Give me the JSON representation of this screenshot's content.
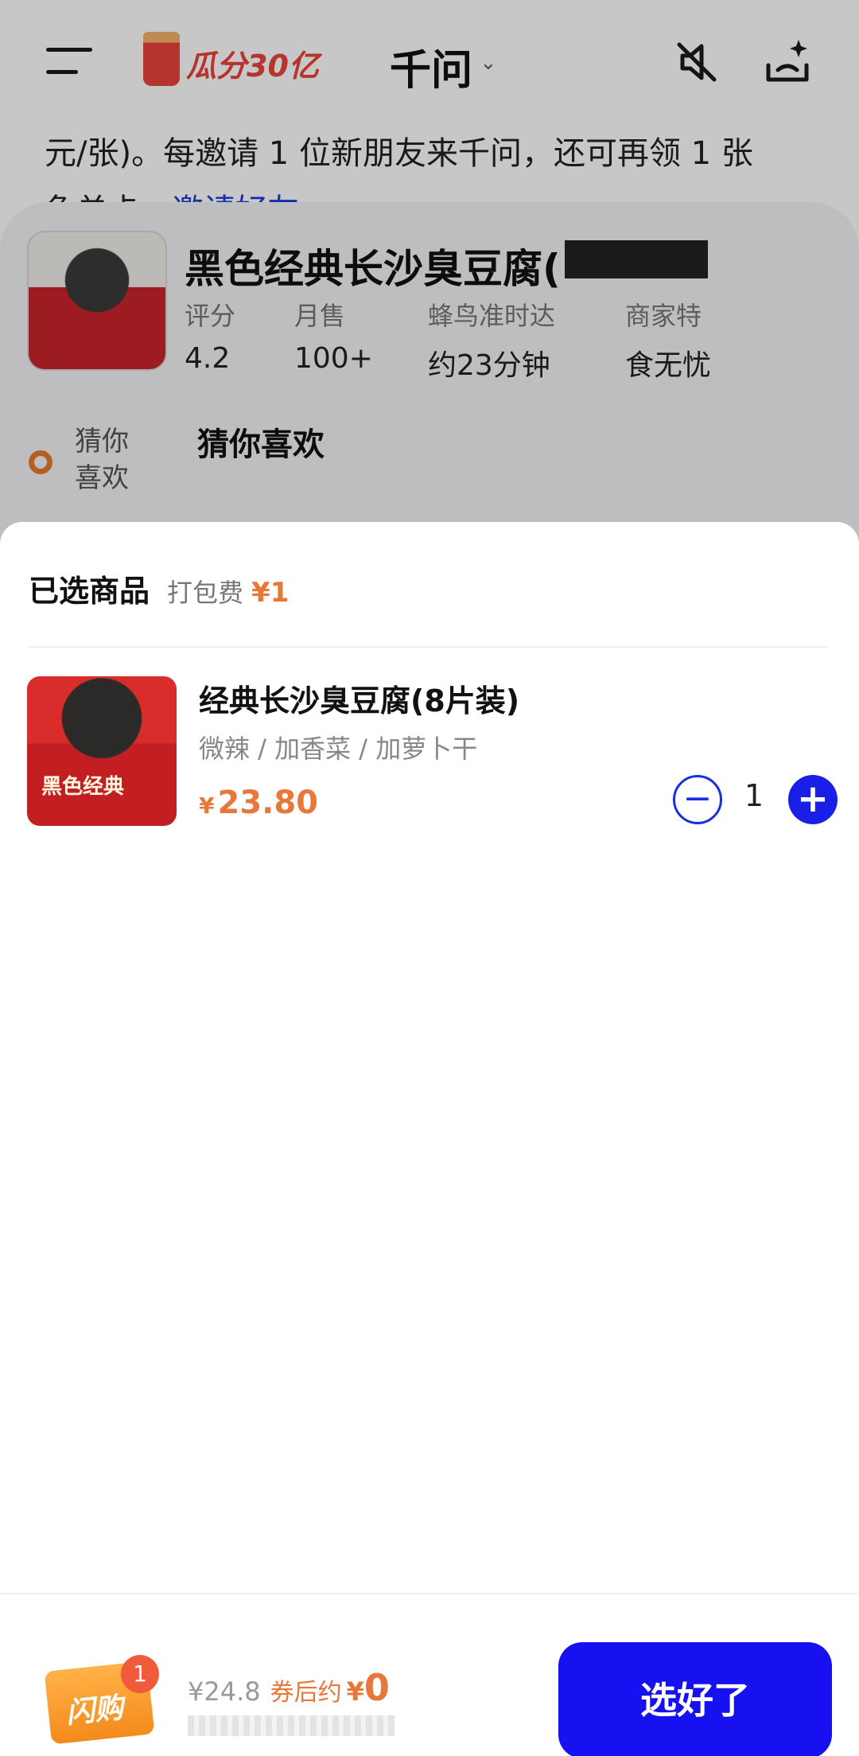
{
  "header": {
    "promo_text": "瓜分30亿",
    "app_title": "千问"
  },
  "chat": {
    "line1": "元/张)。每邀请 1 位新朋友来千问，还可再领 1 张",
    "line2_prefix": "免单卡，",
    "invite_link": "邀请好友"
  },
  "store": {
    "name": "黑色经典长沙臭豆腐(",
    "stats": [
      {
        "label": "评分",
        "value": "4.2"
      },
      {
        "label": "月售",
        "value": "100+"
      },
      {
        "label": "蜂鸟准时达",
        "value": "约23分钟"
      },
      {
        "label": "商家特",
        "value": "食无忧"
      }
    ],
    "guess_side": [
      "猜你",
      "喜欢"
    ],
    "guess_title": "猜你喜欢"
  },
  "cart": {
    "title": "已选商品",
    "pack_label": "打包费",
    "pack_fee": "¥1",
    "items": [
      {
        "name": "经典长沙臭豆腐(8片装)",
        "spec": "微辣 / 加香菜 / 加萝卜干",
        "currency": "¥",
        "price": "23.80",
        "quantity": "1",
        "image_label": "黑色经典"
      }
    ]
  },
  "bottom": {
    "bag_label": "闪购",
    "badge_count": "1",
    "original_price": "¥24.8",
    "after_label": "券后约",
    "after_currency": "¥",
    "after_price": "0",
    "confirm_label": "选好了"
  },
  "colors": {
    "accent_blue": "#1710f0",
    "price_orange": "#e8773a"
  },
  "icons": [
    "menu-icon",
    "mute-icon",
    "sparkle-icon",
    "minus-icon",
    "plus-icon"
  ]
}
